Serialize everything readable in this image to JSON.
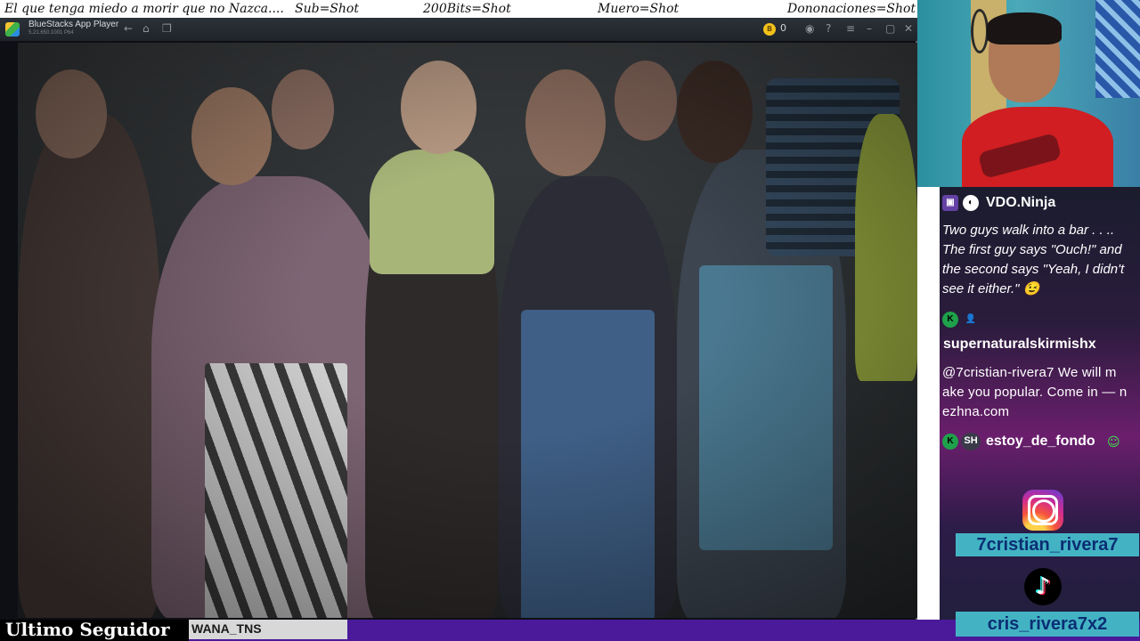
{
  "ticker": {
    "items": [
      "El que tenga miedo a morir que no Nazca....",
      "Sub=Shot",
      "200Bits=Shot",
      "Muero=Shot",
      "Dononaciones=Shot"
    ]
  },
  "window": {
    "title": "BlueStacks App Player",
    "version": "5.21.650.1001 P64",
    "coins": "0",
    "icons": [
      "back-icon",
      "home-icon",
      "multi-instance-icon",
      "coin-icon",
      "account-icon",
      "help-icon",
      "menu-icon",
      "minimize-icon",
      "restore-icon",
      "close-icon"
    ]
  },
  "chat": {
    "messages": [
      {
        "user": "VDO.Ninja",
        "text": "Two guys walk into a bar . . .. The first guy says \"Ouch!\" and the second says \"Yeah, I didn't see it either.\""
      },
      {
        "user": "supernaturalskirmishx",
        "text": "@7cristian-rivera7 We will m ake you popular. Come in — n ezhna.com"
      },
      {
        "user": "estoy_de_fondo",
        "badge2": "SH"
      }
    ]
  },
  "socials": {
    "instagram": "7cristian_rivera7",
    "tiktok": "cris_rivera7x2"
  },
  "bottom": {
    "label": "Ultimo Seguidor",
    "name": "WANA_TNS"
  },
  "colors": {
    "handle_bg": "#43b3c4",
    "handle_text": "#0b2e73",
    "bottom_bar": "#4a1a9a"
  }
}
